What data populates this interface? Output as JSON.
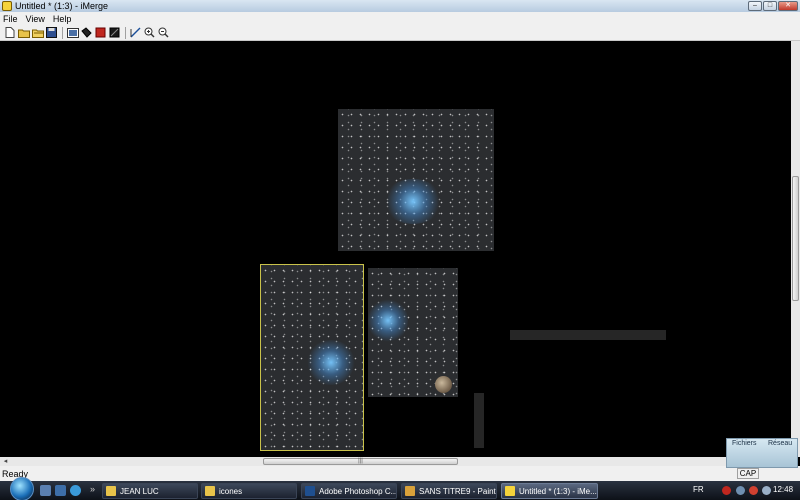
{
  "window": {
    "title": "Untitled * (1:3) - iMerge",
    "controls": {
      "minimize": "–",
      "maximize": "□",
      "close": "✕"
    }
  },
  "menu": {
    "items": [
      "File",
      "View",
      "Help"
    ]
  },
  "toolbar": {
    "icons": [
      "new-file-icon",
      "open-folder-icon",
      "open-icon",
      "save-icon",
      "image-icon",
      "bucket-icon",
      "red-square-icon",
      "black-square-icon",
      "line-icon",
      "zoom-in-icon",
      "zoom-out-icon"
    ]
  },
  "canvas": {
    "background": "#000000"
  },
  "status": {
    "text": "Ready",
    "cap": "CAP"
  },
  "gadget": {
    "tab1": "Fichiers",
    "tab2": "Réseau"
  },
  "taskbar": {
    "more": "»",
    "tasks": [
      "JEAN LUC",
      "icones",
      "Adobe Photoshop C...",
      "SANS TITRE9 - Paint",
      "Untitled * (1:3) - iMe..."
    ],
    "language": "FR",
    "clock": "12:48"
  }
}
